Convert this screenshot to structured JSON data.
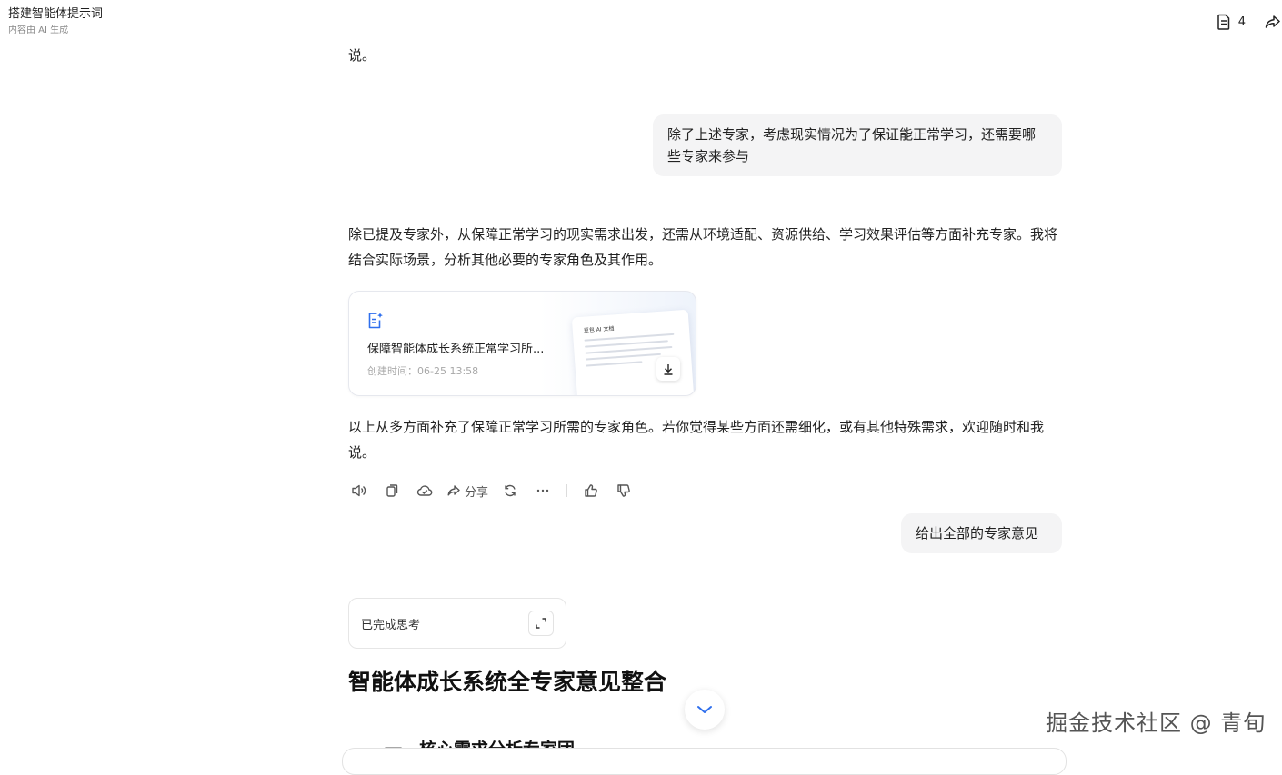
{
  "header": {
    "title": "搭建智能体提示词",
    "subtitle": "内容由 AI 生成",
    "doc_count": "4",
    "icons": {
      "doc": "document-icon",
      "share": "share-icon"
    }
  },
  "messages": {
    "prev_tail": "说。",
    "user_1": "除了上述专家，考虑现实情况为了保证能正常学习，还需要哪些专家来参与",
    "ai_intro": "除已提及专家外，从保障正常学习的现实需求出发，还需从环境适配、资源供给、学习效果评估等方面补充专家。我将结合实际场景，分析其他必要的专家角色及其作用。",
    "doc_card": {
      "title": "保障智能体成长系统正常学习所...",
      "created": "创建时间：06-25 13:58",
      "preview_title": "豆包 AI 文档",
      "icon": "ai-doc-icon"
    },
    "ai_outro": "以上从多方面补充了保障正常学习所需的专家角色。若你觉得某些方面还需细化，或有其他特殊需求，欢迎随时和我说。",
    "user_2": "给出全部的专家意见"
  },
  "actions": {
    "share_label": "分享",
    "icons": [
      "speaker-icon",
      "copy-icon",
      "cloud-save-icon",
      "share-icon",
      "regenerate-icon",
      "more-icon",
      "thumbs-up-icon",
      "thumbs-down-icon"
    ]
  },
  "thinking": {
    "label": "已完成思考",
    "icon": "expand-icon"
  },
  "response": {
    "heading": "智能体成长系统全专家意见整合",
    "subheading": "一、核心需求分析专家团"
  },
  "watermark": "掘金技术社区 @ 青旬",
  "colors": {
    "accent": "#2f6fed",
    "bubble_bg": "#f4f4f5",
    "muted": "#8a8a8a"
  }
}
